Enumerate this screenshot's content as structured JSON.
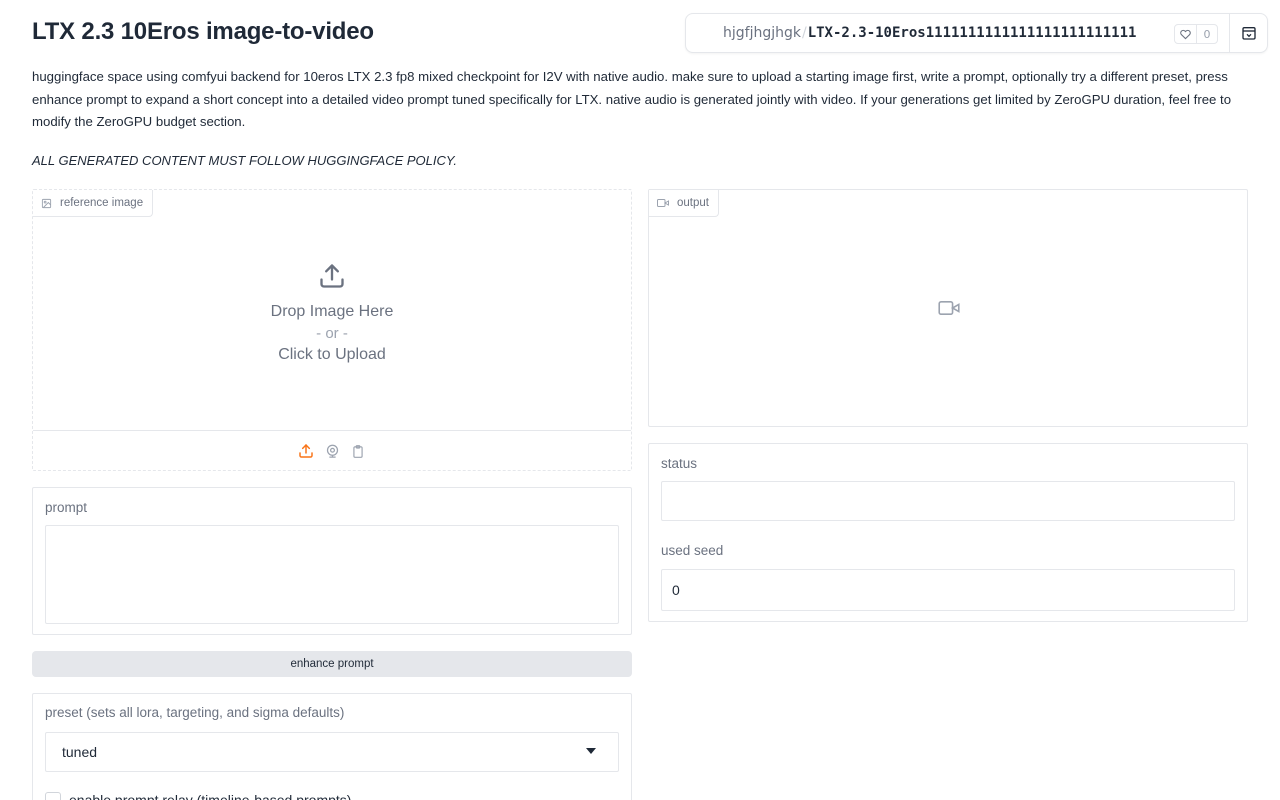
{
  "header": {
    "title": "LTX 2.3 10Eros image-to-video",
    "owner": "hjgfjhgjhgk",
    "separator": "/",
    "space_name": "LTX-2.3-10Eros1111111111111111111111111",
    "likes": "0"
  },
  "description": "huggingface space using comfyui backend for 10eros LTX 2.3 fp8 mixed checkpoint for I2V with native audio. make sure to upload a starting image first, write a prompt, optionally try a different preset, press enhance prompt to expand a short concept into a detailed video prompt tuned specifically for LTX. native audio is generated jointly with video. If your generations get limited by ZeroGPU duration, feel free to modify the ZeroGPU budget section.",
  "policy": "ALL GENERATED CONTENT MUST FOLLOW HUGGINGFACE POLICY.",
  "upload": {
    "label": "reference image",
    "drop_text": "Drop Image Here",
    "or_text": "- or -",
    "click_text": "Click to Upload"
  },
  "output": {
    "label": "output"
  },
  "prompt": {
    "label": "prompt",
    "value": ""
  },
  "enhance_button": "enhance prompt",
  "status": {
    "label": "status",
    "value": ""
  },
  "seed": {
    "label": "used seed",
    "value": "0"
  },
  "preset": {
    "label": "preset (sets all lora, targeting, and sigma defaults)",
    "selected": "tuned"
  },
  "relay": {
    "label": "enable prompt relay (timeline-based prompts)"
  },
  "colors": {
    "accent": "#f97316",
    "border": "#e5e7eb",
    "text": "#1f2937",
    "muted": "#6b7280"
  }
}
